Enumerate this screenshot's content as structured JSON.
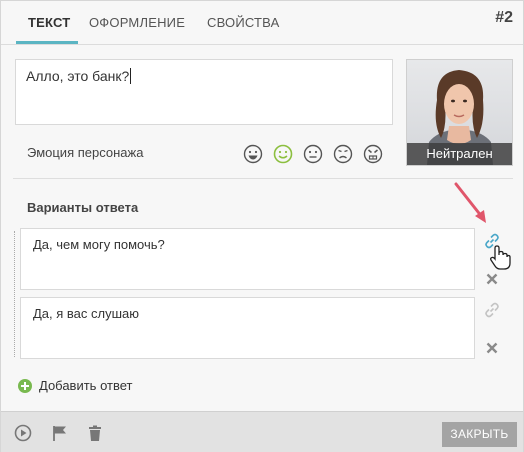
{
  "tabs": [
    {
      "label": "ТЕКСТ",
      "active": true
    },
    {
      "label": "ОФОРМЛЕНИЕ",
      "active": false
    },
    {
      "label": "СВОЙСТВА",
      "active": false
    }
  ],
  "scene_number": "#2",
  "phrase": {
    "value": "Алло, это банк?"
  },
  "character": {
    "emotion_caption": "Нейтрален"
  },
  "emotion": {
    "label": "Эмоция персонажа",
    "options": [
      {
        "icon": "smile-big-icon",
        "selected": false
      },
      {
        "icon": "smile-icon",
        "selected": true
      },
      {
        "icon": "neutral-face-icon",
        "selected": false
      },
      {
        "icon": "sad-face-icon",
        "selected": false
      },
      {
        "icon": "angry-face-icon",
        "selected": false
      }
    ]
  },
  "answers": {
    "label": "Варианты ответа",
    "items": [
      {
        "text": "Да, чем могу помочь?",
        "link_active": true
      },
      {
        "text": "Да, я вас слушаю",
        "link_active": false
      }
    ],
    "add_label": "Добавить ответ"
  },
  "footer": {
    "close_label": "ЗАКРЫТЬ",
    "icons": [
      "play-icon",
      "flag-icon",
      "trash-icon"
    ]
  },
  "colors": {
    "accent": "#5bb5c3",
    "selected_emotion": "#8cbf3f",
    "link_active": "#4aa7c9",
    "add_green": "#79b94f",
    "pointer_arrow": "#e0566b"
  }
}
